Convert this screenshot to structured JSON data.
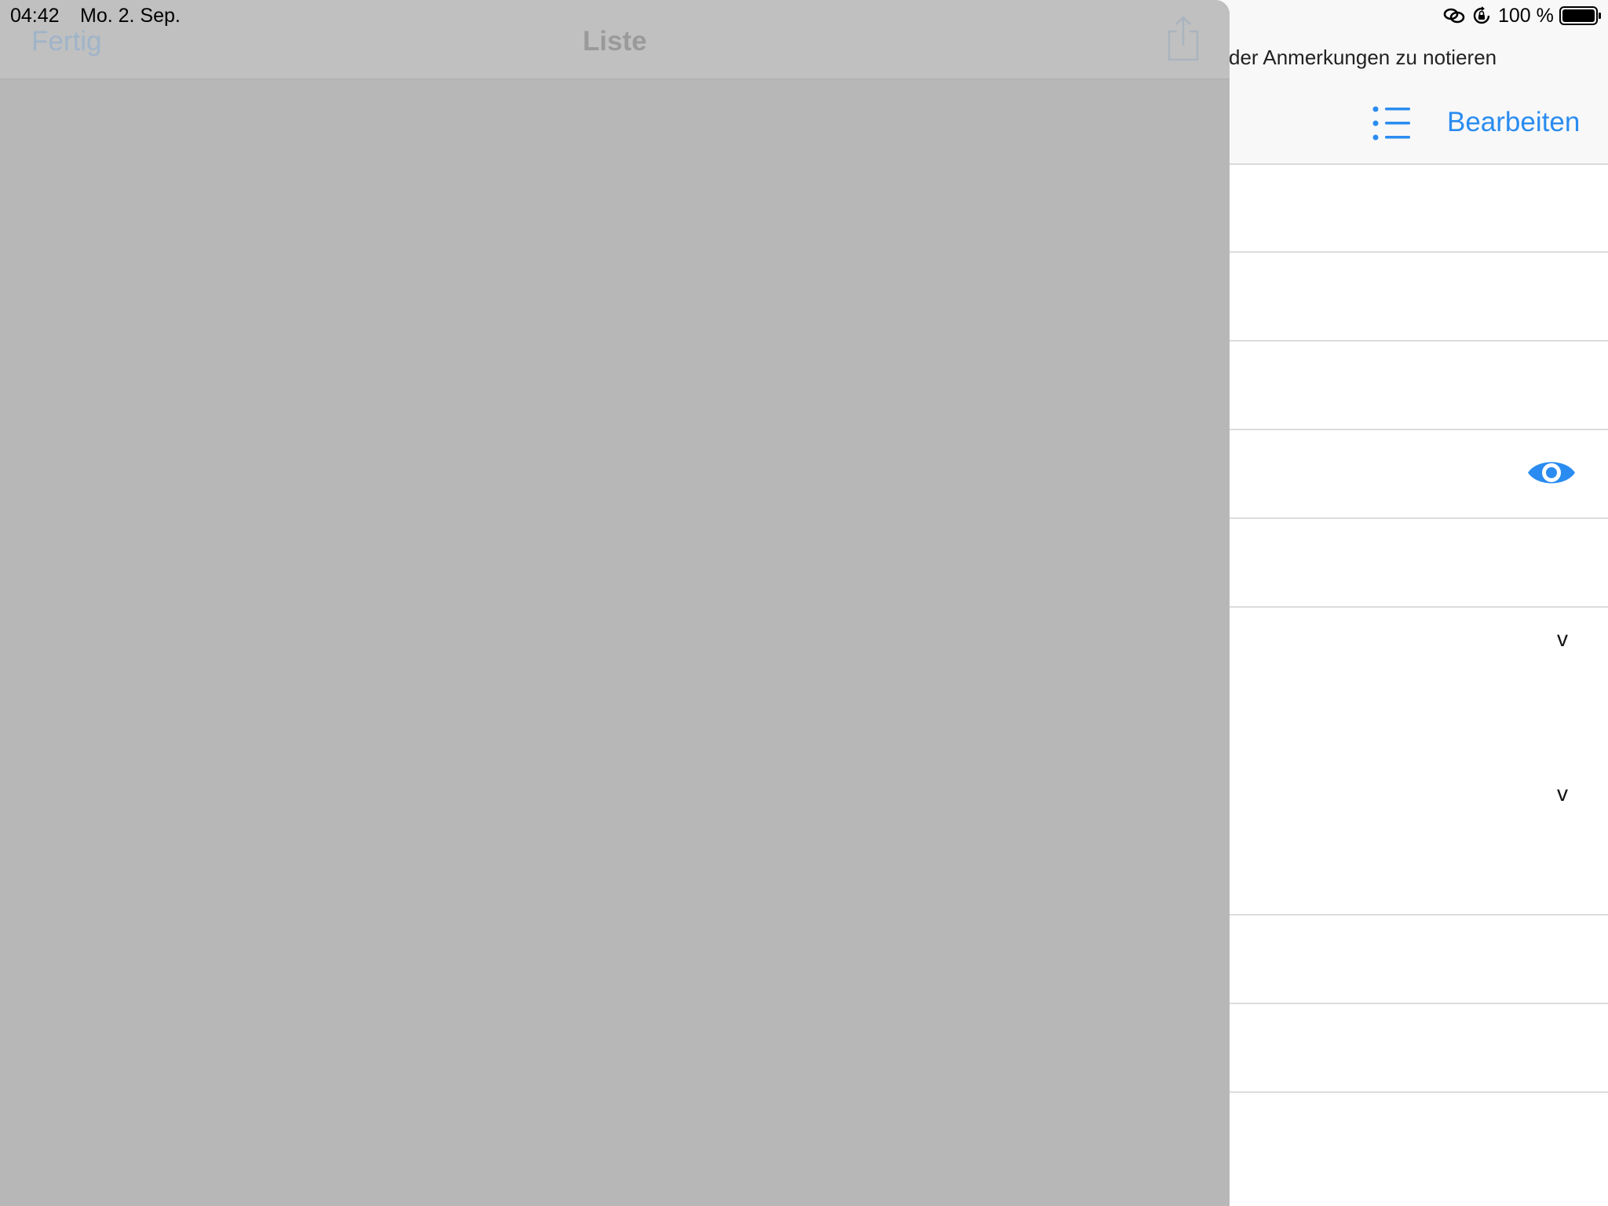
{
  "status_bar": {
    "time": "04:42",
    "date": "Mo. 2. Sep.",
    "battery_percent": "100 %",
    "icons": [
      "link-icon",
      "orientation-lock-icon",
      "battery-icon"
    ]
  },
  "sheet": {
    "done_label": "Fertig",
    "title": "Liste",
    "share_icon": "share-icon",
    "dimmed_color": "#b7b7b7"
  },
  "background_app": {
    "subtitle": "der Anmerkungen zu notieren",
    "list_icon": "list-icon",
    "edit_label": "Bearbeiten",
    "rows": [
      {
        "accessory": ""
      },
      {
        "accessory": ""
      },
      {
        "accessory": ""
      },
      {
        "accessory": "eye-icon"
      },
      {
        "accessory": ""
      },
      {
        "accessory": "v"
      },
      {
        "accessory": "v"
      },
      {
        "accessory": ""
      },
      {
        "accessory": ""
      }
    ],
    "accent_color": "#2a8cf0"
  }
}
